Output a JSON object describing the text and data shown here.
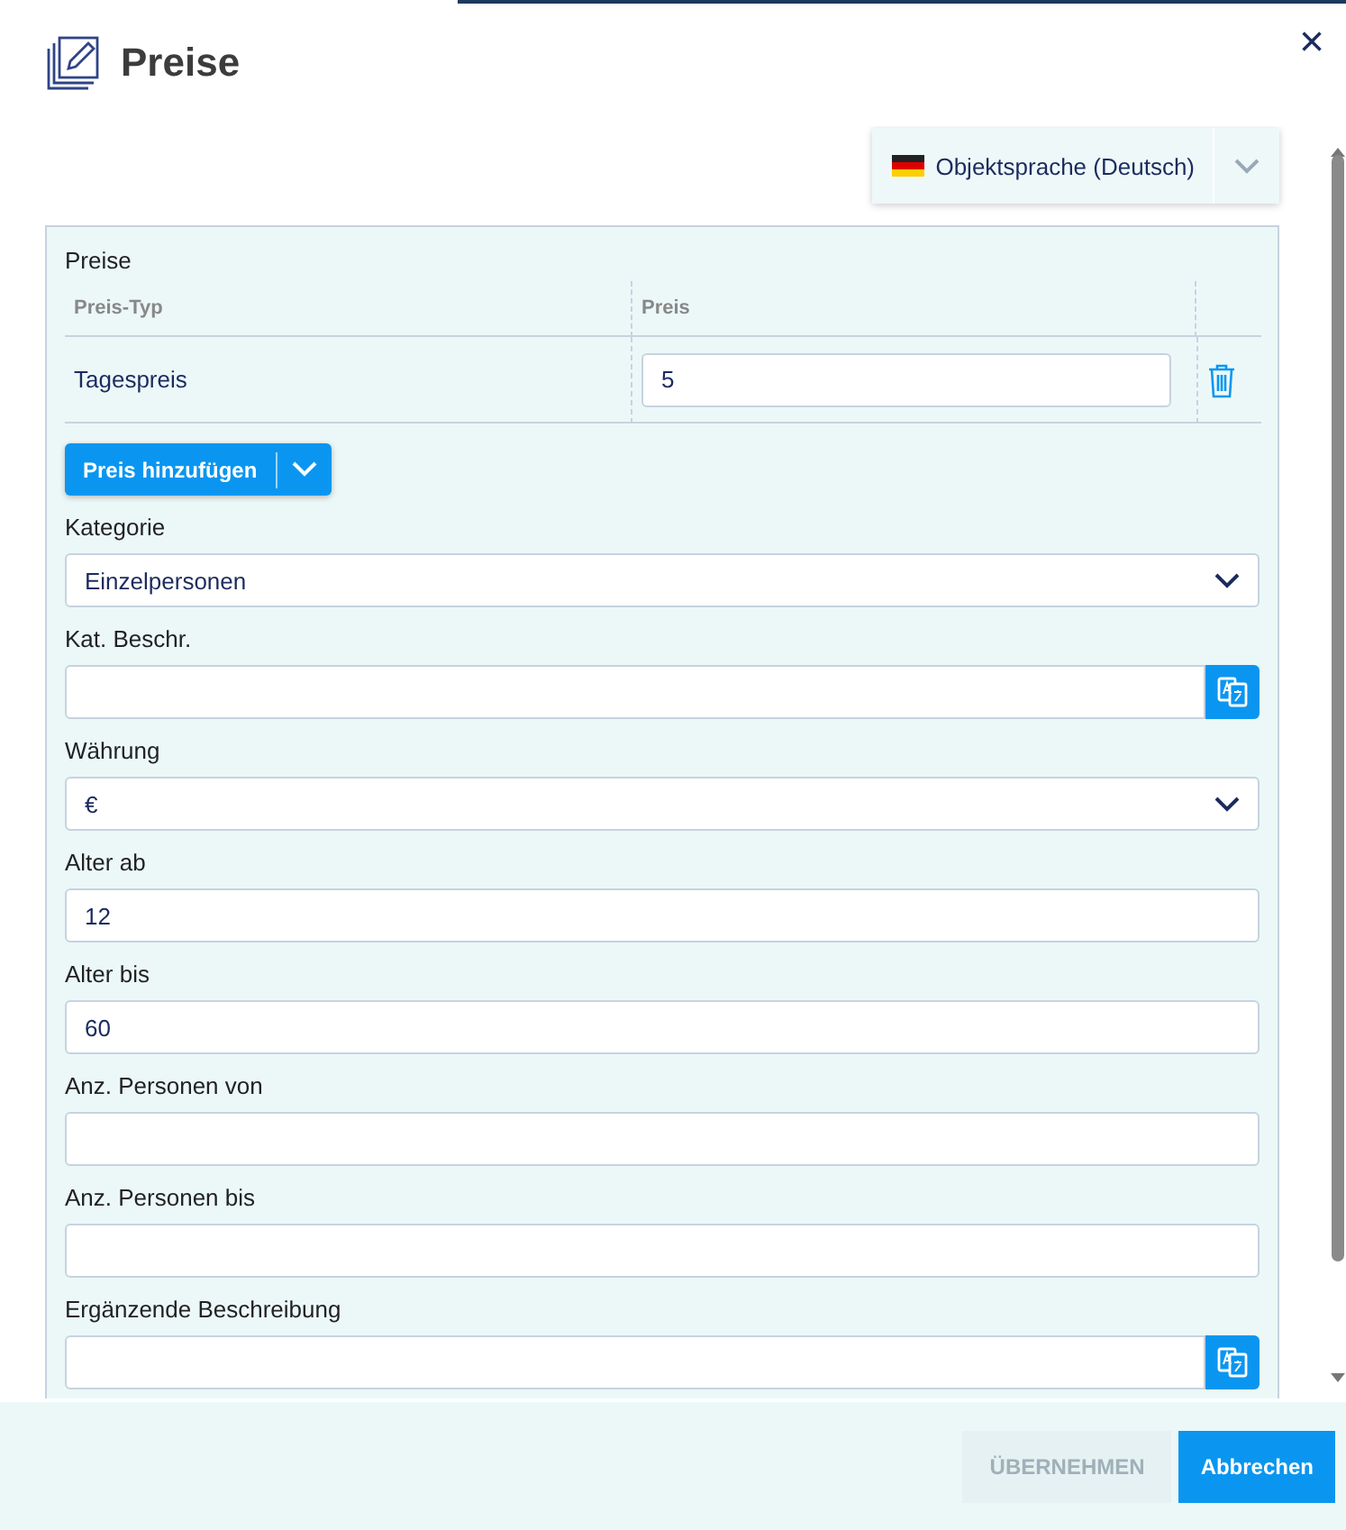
{
  "dialog": {
    "title": "Preise",
    "close": "×"
  },
  "language": {
    "label": "Objektsprache (Deutsch)"
  },
  "prices": {
    "title": "Preise",
    "columns": [
      "Preis-Typ",
      "Preis"
    ],
    "rows": [
      {
        "type": "Tagespreis",
        "price": "5"
      }
    ],
    "add_button": "Preis hinzufügen"
  },
  "fields": [
    {
      "label": "Kategorie",
      "kind": "select",
      "value": "Einzelpersonen"
    },
    {
      "label": "Kat. Beschr.",
      "kind": "translate"
    },
    {
      "label": "Währung",
      "kind": "select",
      "value": "€"
    },
    {
      "label": "Alter ab",
      "kind": "input",
      "value": "12"
    },
    {
      "label": "Alter bis",
      "kind": "input",
      "value": "60"
    },
    {
      "label": "Anz. Personen von",
      "kind": "input"
    },
    {
      "label": "Anz. Personen bis",
      "kind": "input"
    },
    {
      "label": "Ergänzende Beschreibung",
      "kind": "translate"
    }
  ],
  "buttons": [
    {
      "label": "ÜBERNEHMEN",
      "disabled": true
    },
    {
      "label": "Abbrechen",
      "disabled": false
    }
  ]
}
